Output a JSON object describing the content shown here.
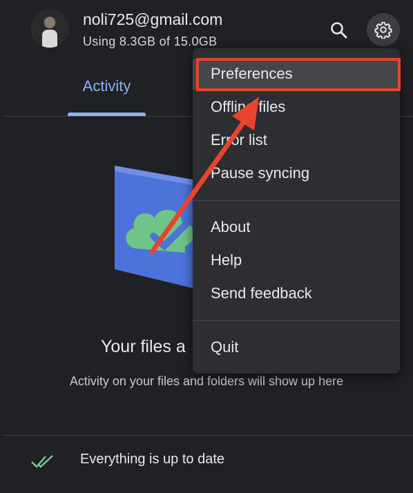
{
  "account": {
    "email": "noli725@gmail.com",
    "storage": "Using 8.3GB of 15.0GB"
  },
  "tabs": [
    {
      "label": "Activity",
      "active": true
    }
  ],
  "empty_state": {
    "title": "Your files a",
    "description": "Activity on your files and folders will show up here"
  },
  "status": {
    "text": "Everything is up to date",
    "icon": "double-check-icon"
  },
  "menu": {
    "items_group1": [
      "Preferences",
      "Offline files",
      "Error list",
      "Pause syncing"
    ],
    "items_group2": [
      "About",
      "Help",
      "Send feedback"
    ],
    "items_group3": [
      "Quit"
    ],
    "highlighted": "Preferences"
  },
  "colors": {
    "accent": "#8ab4f8",
    "highlight": "#e8432f",
    "check": "#81c995"
  }
}
